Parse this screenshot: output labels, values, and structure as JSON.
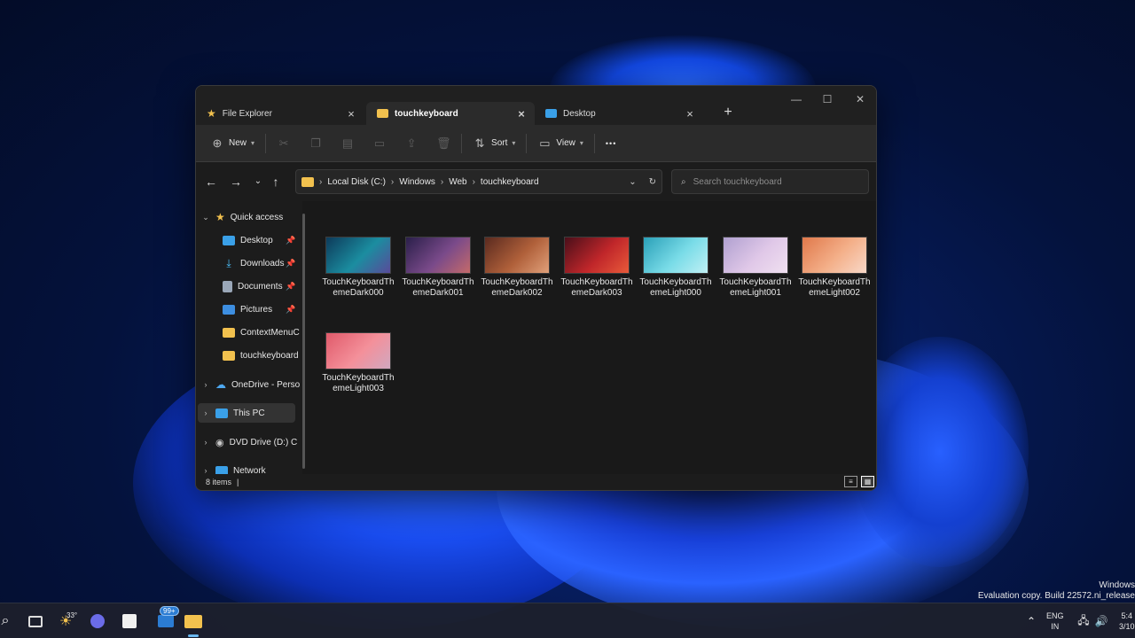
{
  "window": {
    "tabs": [
      {
        "label": "File Explorer",
        "icon": "star-icon",
        "active": false
      },
      {
        "label": "touchkeyboard",
        "icon": "folder-icon",
        "active": true
      },
      {
        "label": "Desktop",
        "icon": "desktop-icon",
        "active": false
      }
    ],
    "new_tab": "+",
    "controls": {
      "minimize": "—",
      "maximize": "☐",
      "close": "✕"
    }
  },
  "toolbar": {
    "new_label": "New",
    "sort_label": "Sort",
    "view_label": "View",
    "more": "•••"
  },
  "address": {
    "crumbs": [
      "Local Disk (C:)",
      "Windows",
      "Web",
      "touchkeyboard"
    ],
    "search_placeholder": "Search touchkeyboard"
  },
  "sidebar": {
    "quick_access": "Quick access",
    "items": [
      {
        "label": "Desktop",
        "pinned": true,
        "icon_color": "#3aa0e8"
      },
      {
        "label": "Downloads",
        "pinned": true,
        "icon_color": "#4cc2ff"
      },
      {
        "label": "Documents",
        "pinned": true,
        "icon_color": "#9aa7b8"
      },
      {
        "label": "Pictures",
        "pinned": true,
        "icon_color": "#3d8ee0"
      },
      {
        "label": "ContextMenuC",
        "pinned": false,
        "icon_color": "#f2c14e"
      },
      {
        "label": "touchkeyboard",
        "pinned": false,
        "icon_color": "#f2c14e"
      }
    ],
    "onedrive": "OneDrive - Perso",
    "this_pc": "This PC",
    "dvd": "DVD Drive (D:) C",
    "network": "Network"
  },
  "files": [
    {
      "name": "TouchKeyboardThemeDark000",
      "colors": [
        "#0d3a5a",
        "#1b8da0",
        "#5a4a9a"
      ]
    },
    {
      "name": "TouchKeyboardThemeDark001",
      "colors": [
        "#2a1f4a",
        "#7a4a8a",
        "#c46a6a"
      ]
    },
    {
      "name": "TouchKeyboardThemeDark002",
      "colors": [
        "#5a2a1f",
        "#b0603a",
        "#e0a07a"
      ]
    },
    {
      "name": "TouchKeyboardThemeDark003",
      "colors": [
        "#4a0f1a",
        "#c0262a",
        "#e85a3a"
      ]
    },
    {
      "name": "TouchKeyboardThemeLight000",
      "colors": [
        "#2aa0b8",
        "#7adce8",
        "#c0f0f4"
      ]
    },
    {
      "name": "TouchKeyboardThemeLight001",
      "colors": [
        "#b0a0d0",
        "#e0c8e8",
        "#f0e0f0"
      ]
    },
    {
      "name": "TouchKeyboardThemeLight002",
      "colors": [
        "#e0784a",
        "#f4b08a",
        "#f8d8c8"
      ]
    },
    {
      "name": "TouchKeyboardThemeLight003",
      "colors": [
        "#e05a6a",
        "#f4909a",
        "#d0a8c0"
      ]
    }
  ],
  "status": {
    "items": "8 items"
  },
  "desktop": {
    "watermark_line1": "Windows",
    "watermark_line2": "Evaluation copy. Build 22572.ni_release"
  },
  "taskbar": {
    "weather_temp": "33°",
    "mail_badge": "99+",
    "lang_line1": "ENG",
    "lang_line2": "IN",
    "time": "5:4",
    "date": "3/10"
  }
}
